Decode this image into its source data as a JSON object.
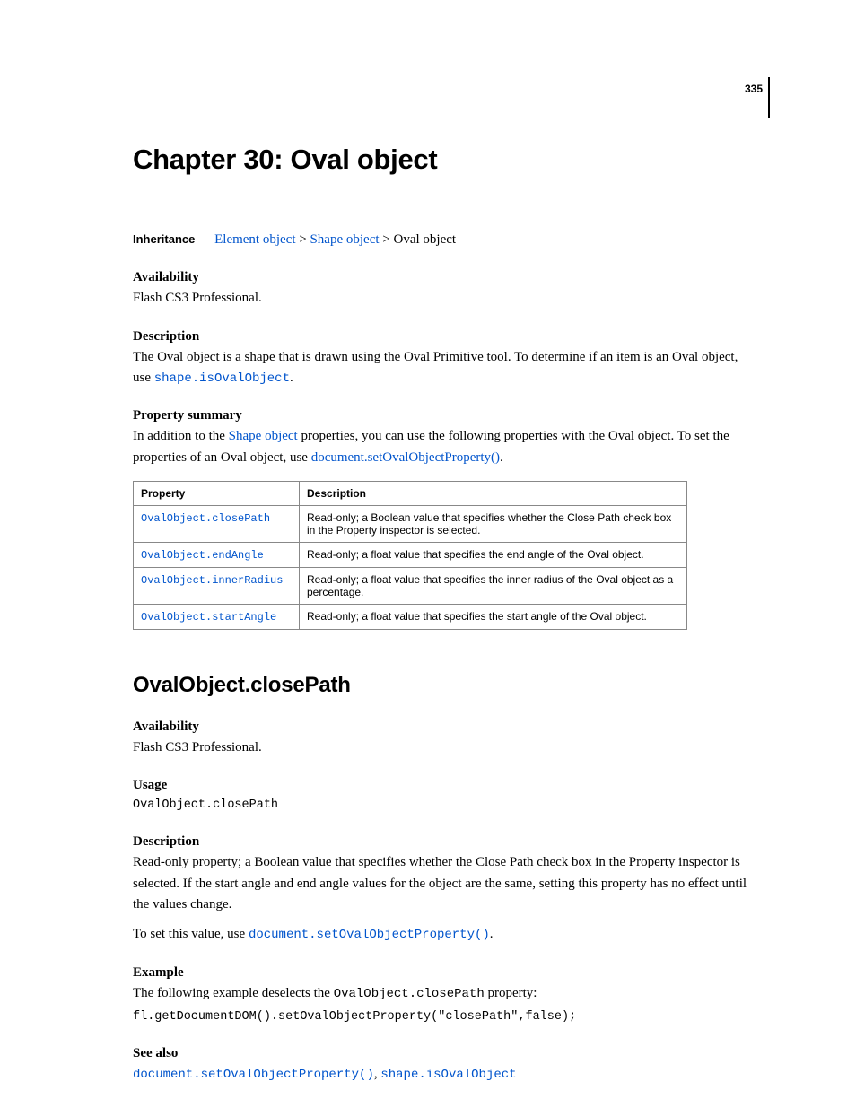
{
  "page_number": "335",
  "chapter_title": "Chapter 30: Oval object",
  "inheritance": {
    "label": "Inheritance",
    "link1": "Element object",
    "sep": " > ",
    "link2": "Shape object",
    "tail": " > Oval object"
  },
  "top": {
    "availability_head": "Availability",
    "availability_text": "Flash CS3 Professional.",
    "description_head": "Description",
    "description_text_pre": "The Oval object is a shape that is drawn using the Oval Primitive tool. To determine if an item is an Oval object, use ",
    "description_link": "shape.isOvalObject",
    "description_text_post": ".",
    "propsum_head": "Property summary",
    "propsum_text_pre": "In addition to the ",
    "propsum_link1": "Shape object",
    "propsum_text_mid": " properties, you can use the following properties with the Oval object. To set the properties of an Oval object, use ",
    "propsum_link2": "document.setOvalObjectProperty()",
    "propsum_text_post": "."
  },
  "table": {
    "head_property": "Property",
    "head_description": "Description",
    "rows": [
      {
        "prop": "OvalObject.closePath",
        "desc": "Read-only; a Boolean value that specifies whether the Close Path check box in the Property inspector is selected."
      },
      {
        "prop": "OvalObject.endAngle",
        "desc": "Read-only; a float value that specifies the end angle of the Oval object."
      },
      {
        "prop": "OvalObject.innerRadius",
        "desc": "Read-only; a float value that specifies the inner radius of the Oval object as a percentage."
      },
      {
        "prop": "OvalObject.startAngle",
        "desc": "Read-only; a float value that specifies the start angle of the Oval object."
      }
    ]
  },
  "section": {
    "title": "OvalObject.closePath",
    "availability_head": "Availability",
    "availability_text": "Flash CS3 Professional.",
    "usage_head": "Usage",
    "usage_code": "OvalObject.closePath",
    "description_head": "Description",
    "description_text": "Read-only property; a Boolean value that specifies whether the Close Path check box in the Property inspector is selected. If the start angle and end angle values for the object are the same, setting this property has no effect until the values change.",
    "setvalue_pre": "To set this value, use ",
    "setvalue_link": "document.setOvalObjectProperty()",
    "setvalue_post": ".",
    "example_head": "Example",
    "example_text_pre": "The following example deselects the ",
    "example_code_inline": "OvalObject.closePath",
    "example_text_post": " property:",
    "example_codeblock": "fl.getDocumentDOM().setOvalObjectProperty(\"closePath\",false);",
    "seealso_head": "See also",
    "seealso_link1": "document.setOvalObjectProperty()",
    "seealso_sep": ", ",
    "seealso_link2": "shape.isOvalObject"
  }
}
